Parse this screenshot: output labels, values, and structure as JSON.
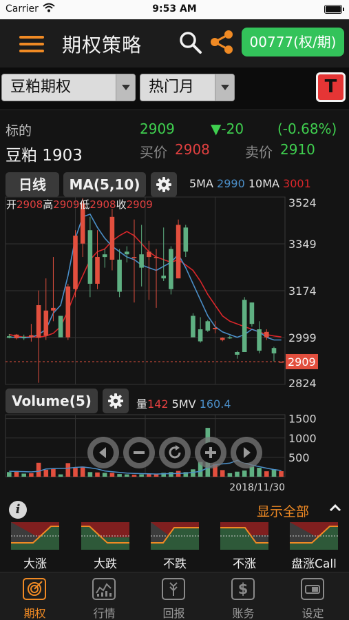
{
  "status_bar": {
    "carrier": "Carrier",
    "time": "9:53 AM"
  },
  "header": {
    "title": "期权策略",
    "code_button": "00777(权/期)"
  },
  "selectors": {
    "product": "豆粕期权",
    "month": "热门月",
    "t_button": "T"
  },
  "underlying": {
    "label": "标的",
    "name": "豆粕 1903",
    "price": "2909",
    "change": "▼-20",
    "change_pct": "(-0.68%)",
    "bid_label": "买价",
    "bid": "2908",
    "ask_label": "卖价",
    "ask": "2910"
  },
  "chart_controls": {
    "period": "日线",
    "ma": "MA(5,10)",
    "volume": "Volume(5)"
  },
  "ma_legend": {
    "ma5_label": "5MA",
    "ma5_value": "2990",
    "ma10_label": "10MA",
    "ma10_value": "3001"
  },
  "ohlc_legend": {
    "open_label": "开",
    "open": "2908",
    "high_label": "高",
    "high": "2909",
    "low_label": "低",
    "low": "2908",
    "close_label": "收",
    "close": "2909"
  },
  "volume_legend": {
    "vol_label": "量",
    "vol_value": "142",
    "mv_label": "5MV",
    "mv_value": "160.4"
  },
  "colors": {
    "up": "#e24f3e",
    "down": "#5fb082",
    "ma5": "#4b8fc9",
    "ma10": "#d9262a",
    "accent": "#f08a24",
    "green_button": "#33c35a",
    "price_green": "#3fcf4f"
  },
  "chart_data": [
    {
      "type": "candlestick",
      "title": "",
      "y_ticks": [
        3524,
        3349,
        3174,
        2999,
        2824
      ],
      "ylim": [
        2824,
        3524
      ],
      "last_price_label": "2909",
      "ohlc": [
        [
          3004,
          3012,
          2996,
          2998
        ],
        [
          2996,
          3012,
          2992,
          3010
        ],
        [
          3002,
          3010,
          2990,
          2998
        ],
        [
          3000,
          3050,
          2984,
          3008
        ],
        [
          2998,
          3175,
          2830,
          3120
        ],
        [
          3006,
          3220,
          2990,
          3100
        ],
        [
          3100,
          3300,
          3060,
          3110
        ],
        [
          3080,
          3060,
          3000,
          3000
        ],
        [
          3000,
          3200,
          2990,
          3190
        ],
        [
          3180,
          3400,
          3150,
          3380
        ],
        [
          3350,
          3520,
          3300,
          3500
        ],
        [
          3400,
          3450,
          3150,
          3200
        ],
        [
          3200,
          3400,
          3180,
          3300
        ],
        [
          3310,
          3330,
          3260,
          3300
        ],
        [
          3290,
          3480,
          3250,
          3450
        ],
        [
          3290,
          3330,
          3150,
          3170
        ],
        [
          3320,
          3340,
          3280,
          3310
        ],
        [
          3300,
          3440,
          3130,
          3300
        ],
        [
          3310,
          3420,
          3190,
          3260
        ],
        [
          3300,
          3360,
          3140,
          3320
        ],
        [
          3300,
          3330,
          3110,
          3300
        ],
        [
          3230,
          3410,
          3210,
          3220
        ],
        [
          3330,
          3340,
          3160,
          3180
        ],
        [
          3220,
          3440,
          3220,
          3420
        ],
        [
          3410,
          3420,
          3300,
          3320
        ],
        [
          3080,
          3090,
          3010,
          3000
        ],
        [
          3030,
          3075,
          2980,
          2985
        ],
        [
          3060,
          3065,
          3020,
          3025
        ],
        [
          3030,
          3060,
          3015,
          3035
        ],
        [
          2990,
          3000,
          2985,
          2998
        ],
        [
          3000,
          3006,
          2994,
          2996
        ],
        [
          2945,
          2950,
          2920,
          2935
        ],
        [
          3140,
          3150,
          2950,
          2945
        ],
        [
          3130,
          3130,
          3040,
          3050
        ],
        [
          3030,
          3060,
          2940,
          2950
        ],
        [
          3000,
          3030,
          2990,
          3020
        ],
        [
          2960,
          2965,
          2910,
          2940
        ],
        [
          2908,
          2909,
          2908,
          2909
        ]
      ],
      "ma5": [
        3000,
        3000,
        2998,
        3000,
        3010,
        3030,
        3090,
        3120,
        3230,
        3370,
        3450,
        3460,
        3410,
        3370,
        3340,
        3320,
        3300,
        3290,
        3270,
        3260,
        3250,
        3265,
        3280,
        3310,
        3260,
        3200,
        3140,
        3080,
        3040,
        3020,
        3010,
        3000,
        3010,
        3030,
        3020,
        3000,
        2990,
        2990
      ],
      "ma10": [
        3010,
        3005,
        3000,
        3002,
        3000,
        3005,
        3015,
        3040,
        3100,
        3170,
        3230,
        3290,
        3320,
        3330,
        3360,
        3380,
        3395,
        3380,
        3350,
        3320,
        3300,
        3290,
        3280,
        3290,
        3270,
        3250,
        3210,
        3160,
        3120,
        3080,
        3060,
        3050,
        3040,
        3030,
        3020,
        3010,
        3005,
        3001
      ]
    },
    {
      "type": "bar",
      "title": "Volume(5)",
      "x_end_label": "2018/11/30",
      "y_ticks": [
        1500,
        1000,
        500
      ],
      "ylim": [
        0,
        1600
      ],
      "values": [
        120,
        150,
        80,
        90,
        360,
        180,
        200,
        60,
        350,
        230,
        260,
        120,
        110,
        100,
        100,
        70,
        60,
        50,
        60,
        70,
        80,
        100,
        120,
        150,
        120,
        190,
        380,
        1260,
        330,
        170,
        90,
        130,
        160,
        260,
        230,
        140,
        190,
        142
      ],
      "mv": [
        140,
        135,
        132,
        125,
        140,
        200,
        210,
        215,
        220,
        240,
        250,
        230,
        200,
        150,
        130,
        110,
        95,
        85,
        80,
        75,
        70,
        75,
        80,
        85,
        90,
        110,
        140,
        230,
        310,
        330,
        350,
        420,
        360,
        300,
        260,
        220,
        185,
        160
      ]
    }
  ],
  "strategy_bar": {
    "show_all": "显示全部"
  },
  "strategies": [
    {
      "label": "大涨",
      "shape": "bull"
    },
    {
      "label": "大跌",
      "shape": "bear"
    },
    {
      "label": "不跌",
      "shape": "notfall"
    },
    {
      "label": "不涨",
      "shape": "notrise"
    },
    {
      "label": "盘涨Call",
      "shape": "bull"
    }
  ],
  "tabs": [
    {
      "label": "期权",
      "icon": "target-icon",
      "active": true
    },
    {
      "label": "行情",
      "icon": "market-chart-icon",
      "active": false
    },
    {
      "label": "回报",
      "icon": "report-icon",
      "active": false
    },
    {
      "label": "账务",
      "icon": "dollar-icon",
      "active": false
    },
    {
      "label": "设定",
      "icon": "settings-toggle-icon",
      "active": false
    }
  ]
}
